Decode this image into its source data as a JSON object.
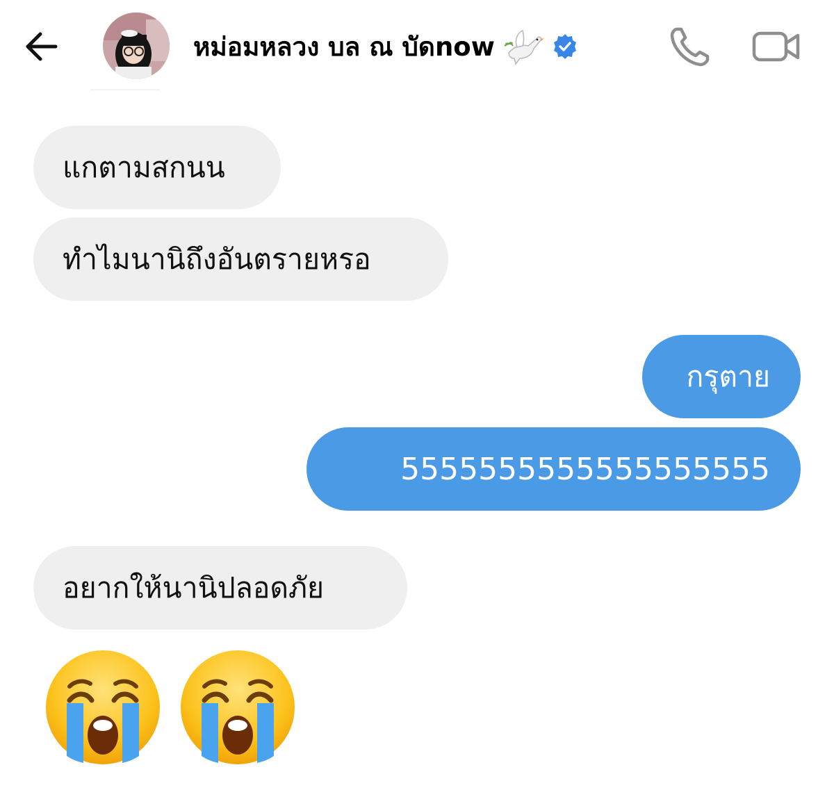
{
  "header": {
    "back_icon": "arrow-left-icon",
    "contact_name": "หม่อมหลวง บล ณ บัดnow",
    "name_emoji": "dove-icon",
    "verified_badge": "verified-icon",
    "call_icon": "phone-icon",
    "video_icon": "video-camera-icon",
    "accent_color": "#3a86e8"
  },
  "messages": [
    {
      "direction": "incoming",
      "text": "แกตามสกนน"
    },
    {
      "direction": "incoming",
      "text": "ทำไมนานิถึงอันตรายหรอ"
    },
    {
      "direction": "outgoing",
      "text": "กรุตาย"
    },
    {
      "direction": "outgoing",
      "text": "5555555555555555555"
    },
    {
      "direction": "incoming",
      "text": "อยากให้นานิปลอดภัย"
    },
    {
      "direction": "incoming",
      "emoji": [
        "loudly-crying-face-icon",
        "loudly-crying-face-icon"
      ]
    }
  ],
  "colors": {
    "incoming_bubble": "#efefef",
    "outgoing_bubble": "#4a9ae6",
    "outgoing_text": "#ffffff",
    "icon_gray": "#8e8e8e"
  }
}
